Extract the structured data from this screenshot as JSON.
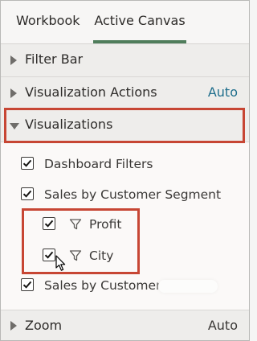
{
  "tabs": {
    "workbook": "Workbook",
    "active_canvas": "Active Canvas"
  },
  "sections": {
    "filter_bar": "Filter Bar",
    "visualization_actions": {
      "label": "Visualization Actions",
      "value": "Auto"
    },
    "visualizations": "Visualizations",
    "zoom": {
      "label": "Zoom",
      "value": "Auto"
    }
  },
  "visualizations": {
    "dashboard_filters": "Dashboard Filters",
    "sales_by_customer_segment": "Sales by Customer Segment",
    "profit": "Profit",
    "city": "City",
    "sales_by_customer": "Sales by Customer"
  },
  "colors": {
    "accent": "#4f7d5b",
    "highlight": "#c74634",
    "link": "#1f6e8c"
  }
}
